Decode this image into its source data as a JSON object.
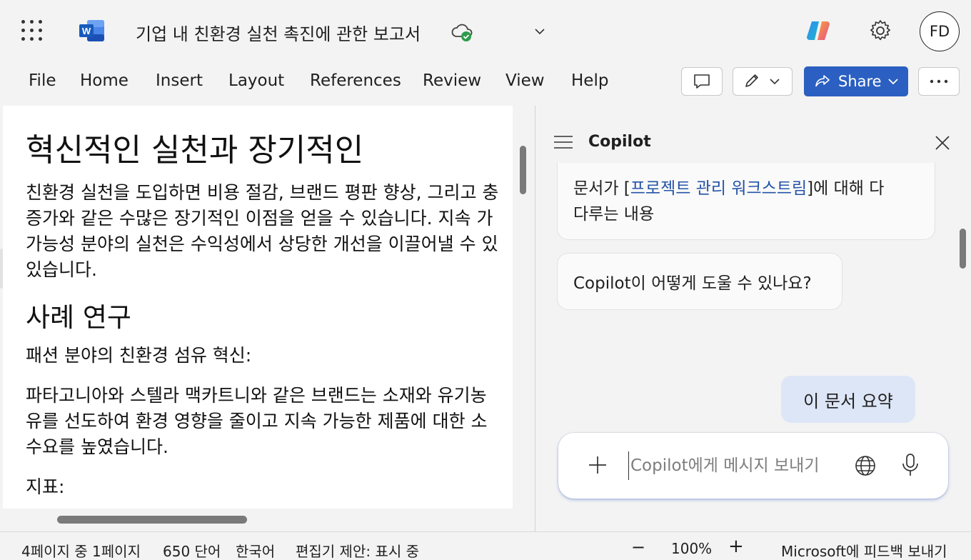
{
  "titlebar": {
    "doc_title": "기업 내 친환경 실천 촉진에 관한 보고서",
    "avatar_initials": "FD"
  },
  "ribbon": {
    "tabs": [
      "File",
      "Home",
      "Insert",
      "Layout",
      "References",
      "Review",
      "View",
      "Help"
    ],
    "share_label": "Share"
  },
  "document": {
    "heading1": "혁신적인 실천과 장기적인",
    "para1": [
      "친환경 실천을 도입하면 비용 절감, 브랜드 평판 향상, 그리고 충",
      "증가와 같은 수많은 장기적인 이점을 얻을 수 있습니다. 지속 가",
      "가능성 분야의 실천은 수익성에서 상당한 개선을 이끌어낼 수 있",
      "있습니다."
    ],
    "heading2": "사례 연구",
    "subhead": "패션 분야의 친환경 섬유 혁신:",
    "para2": [
      "파타고니아와 스텔라 맥카트니와 같은 브랜드는 소재와 유기농",
      "유를 선도하여 환경 영향을 줄이고 지속 가능한 제품에 대한 소",
      "수요를 높였습니다."
    ],
    "subhead2": "지표:"
  },
  "copilot": {
    "title": "Copilot",
    "bubble1_line1_pre": "문서가 [",
    "bubble1_link": "프로젝트 관리 워크스트림",
    "bubble1_line1_post": "]에 대해 다",
    "bubble1_line2": "다루는 내용",
    "bubble2": "Copilot이 어떻게 도울 수 있나요?",
    "user_message": "이 문서 요약",
    "input_placeholder": "Copilot에게 메시지 보내기"
  },
  "statusbar": {
    "page": "4페이지 중 1페이지",
    "words": "650 단어",
    "language": "한국어",
    "editor": "편집기 제안: 표시 중",
    "zoom_out": "−",
    "zoom": "100%",
    "zoom_in": "+",
    "feedback": "Microsoft에 피드백 보내기"
  },
  "colors": {
    "accent": "#2b5fc1",
    "link": "#2553a8",
    "user_bubble": "#dde6f6"
  }
}
